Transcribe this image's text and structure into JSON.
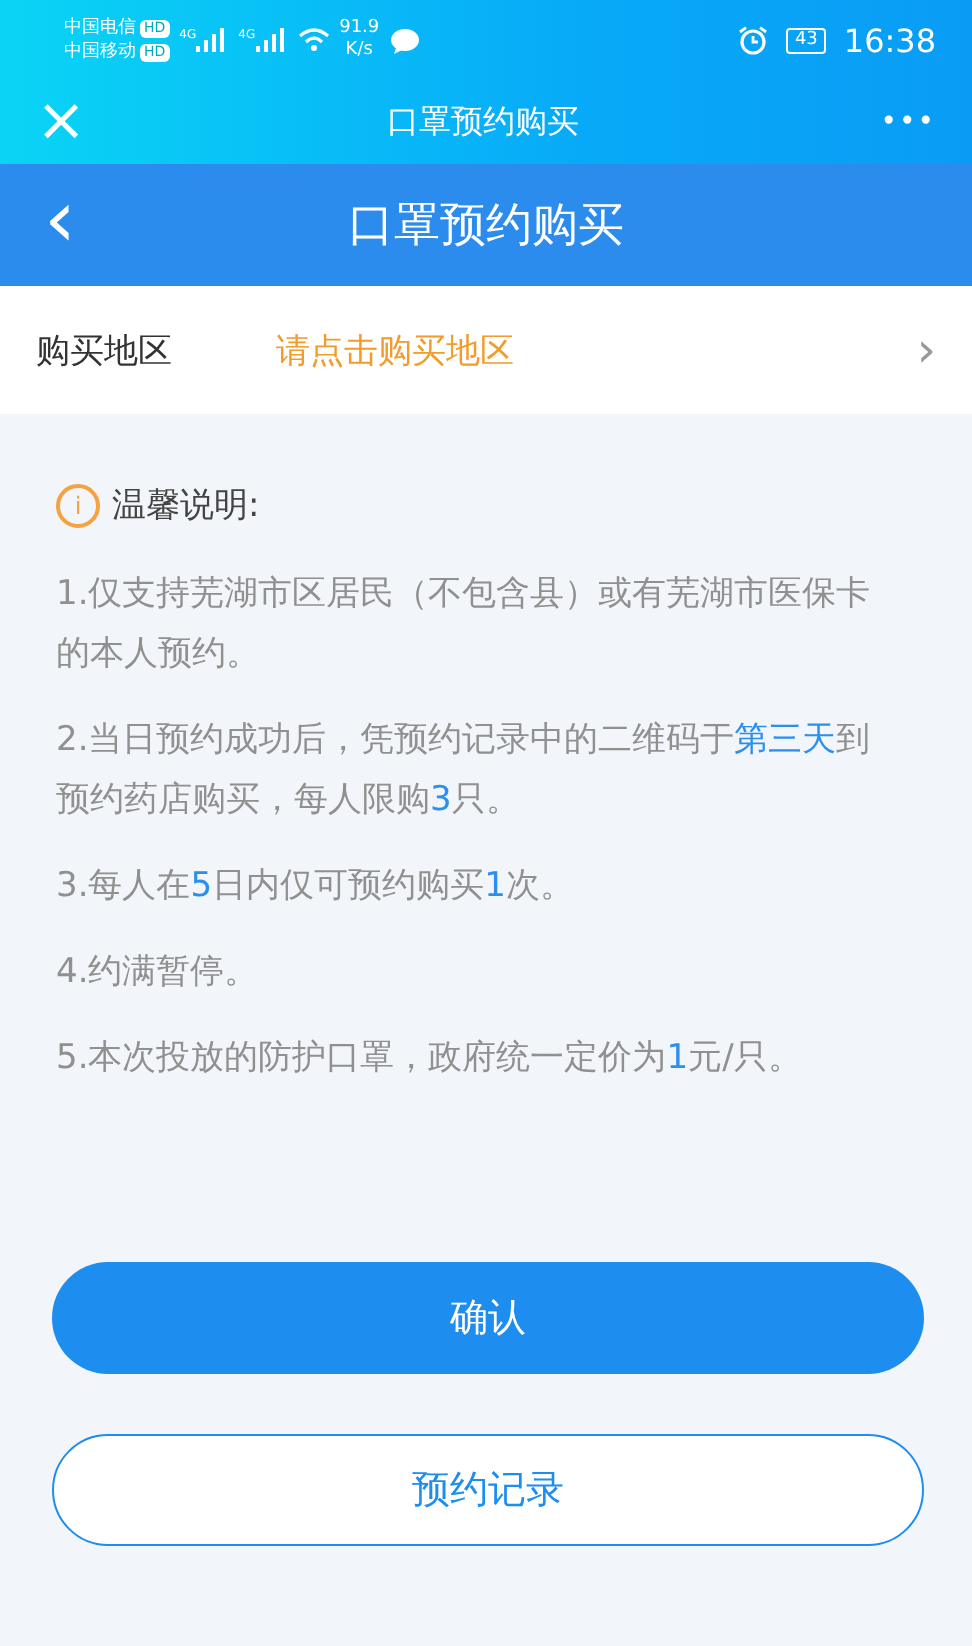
{
  "status_bar": {
    "carriers": [
      {
        "name": "中国电信",
        "badge": "HD",
        "network": "4G"
      },
      {
        "name": "中国移动",
        "badge": "HD",
        "network": "4G"
      }
    ],
    "speed": "91.9",
    "speed_unit": "K/s",
    "battery": "43",
    "time": "16:38"
  },
  "app_bar": {
    "close": "×",
    "title": "口罩预约购买",
    "more": "•••"
  },
  "header": {
    "back": "‹",
    "title": "口罩预约购买"
  },
  "region": {
    "label": "购买地区",
    "placeholder": "请点击购买地区",
    "chevron": "›"
  },
  "notice": {
    "title": "温馨说明:",
    "icon": "i",
    "items": [
      [
        {
          "text": "1.仅支持芜湖市区居民（不包含县）或有芜湖市医保卡的本人预约。",
          "highlight": false
        }
      ],
      [
        {
          "text": "2.当日预约成功后，凭预约记录中的二维码于",
          "highlight": false
        },
        {
          "text": "第三天",
          "highlight": true
        },
        {
          "text": "到预约药店购买，每人限购",
          "highlight": false
        },
        {
          "text": "3",
          "highlight": true
        },
        {
          "text": "只。",
          "highlight": false
        }
      ],
      [
        {
          "text": "3.每人在",
          "highlight": false
        },
        {
          "text": "5",
          "highlight": true
        },
        {
          "text": "日内仅可预约购买",
          "highlight": false
        },
        {
          "text": "1",
          "highlight": true
        },
        {
          "text": "次。",
          "highlight": false
        }
      ],
      [
        {
          "text": "4.约满暂停。",
          "highlight": false
        }
      ],
      [
        {
          "text": "5.本次投放的防护口罩，政府统一定价为",
          "highlight": false
        },
        {
          "text": "1",
          "highlight": true
        },
        {
          "text": "元/只。",
          "highlight": false
        }
      ]
    ]
  },
  "buttons": [
    {
      "label": "确认",
      "kind": "primary"
    },
    {
      "label": "预约记录",
      "kind": "outline"
    }
  ]
}
